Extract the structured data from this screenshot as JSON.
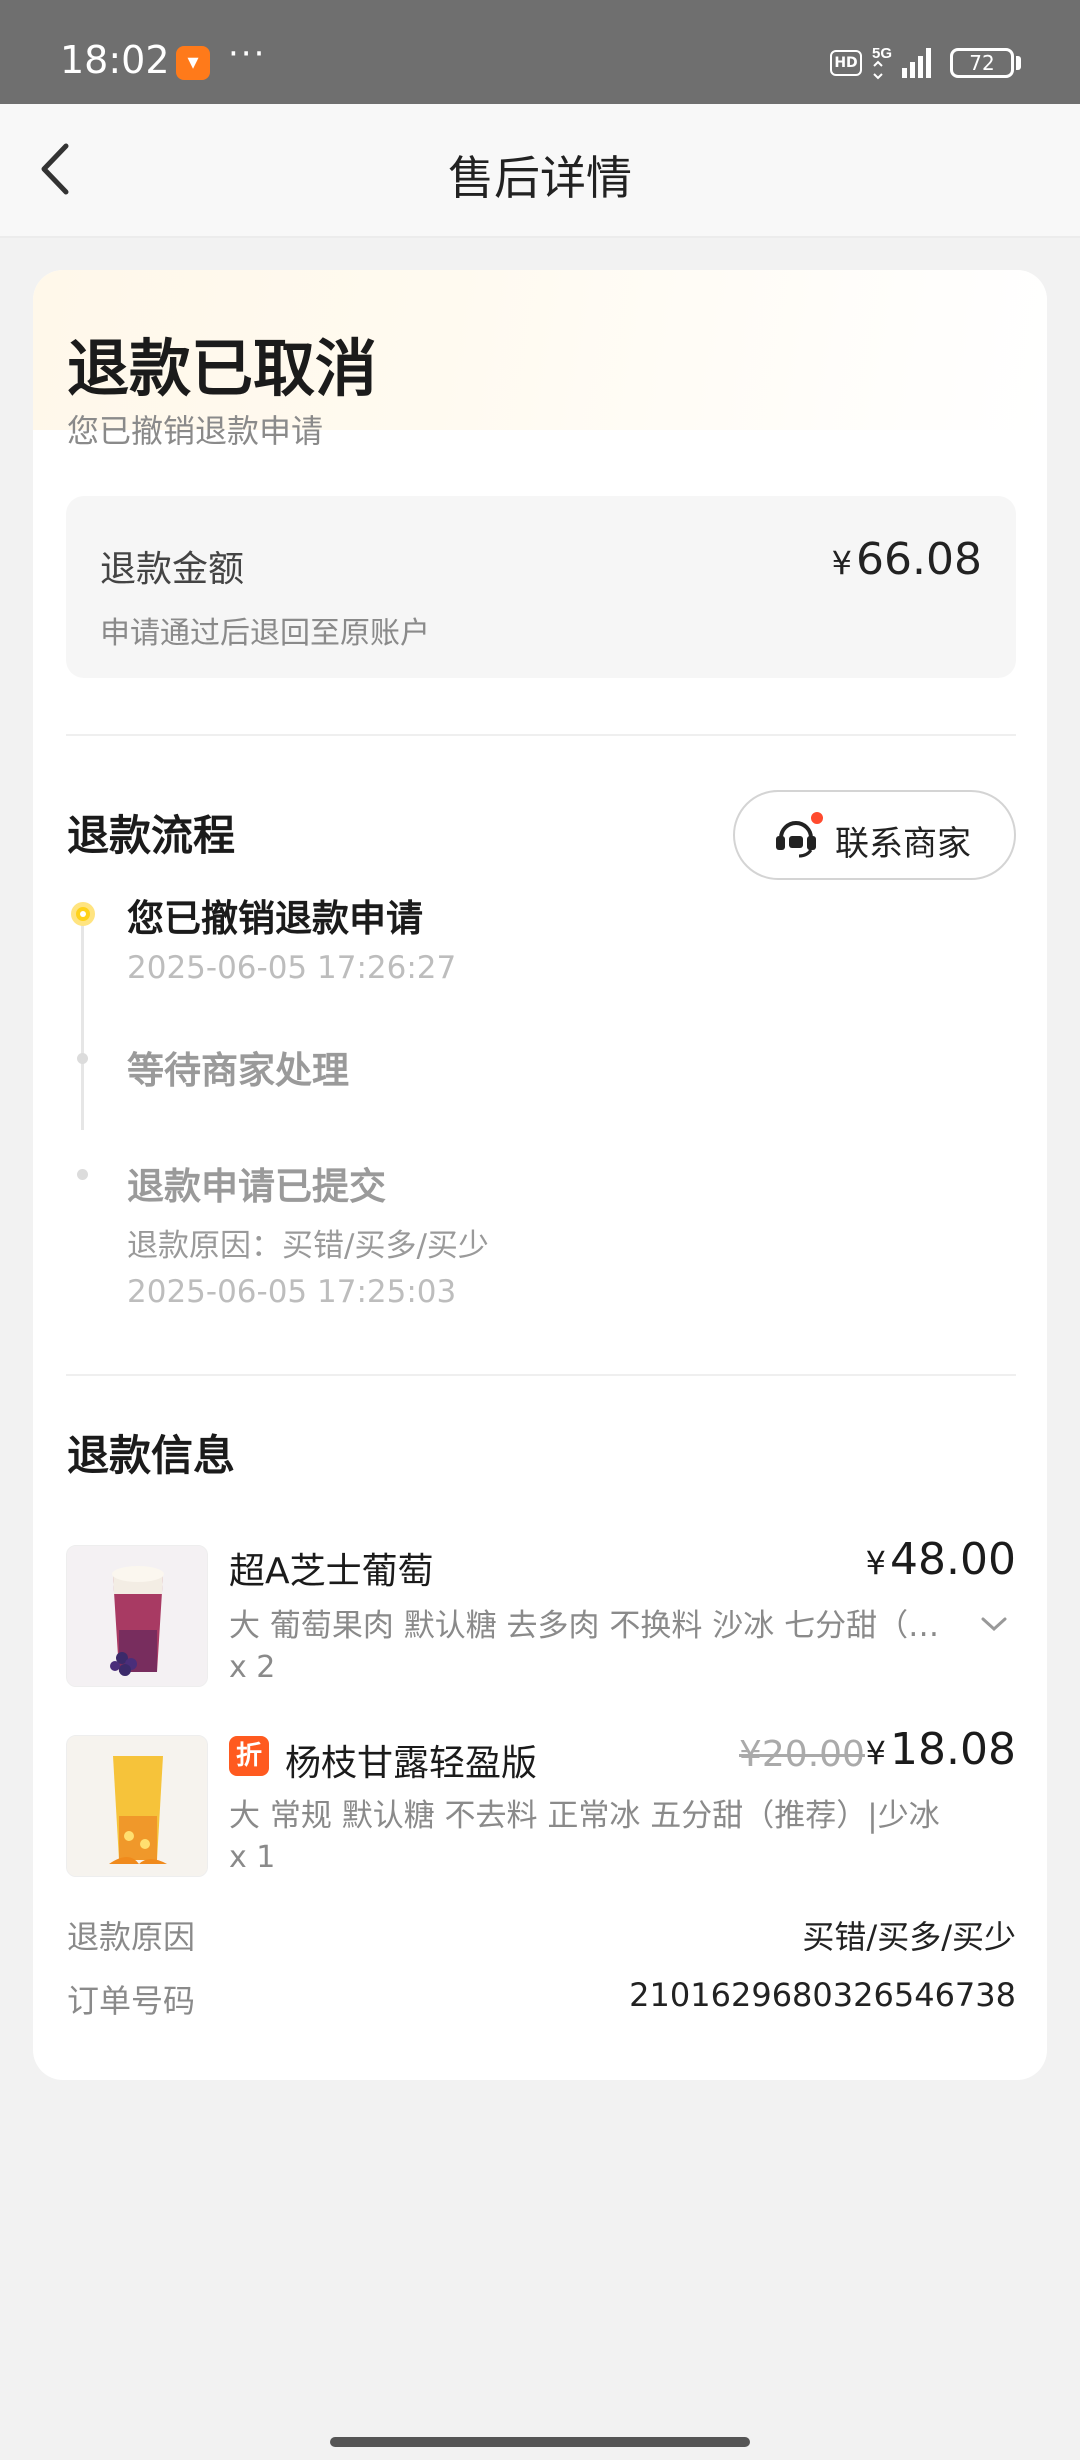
{
  "status_bar": {
    "time": "18:02",
    "app_icon": "meituan-app-icon",
    "more_dots": "···",
    "hd_label": "HD",
    "network_label": "5G",
    "battery_level": "72"
  },
  "nav": {
    "back_icon": "chevron-left-icon",
    "title": "售后详情"
  },
  "refund_status": {
    "title": "退款已取消",
    "description": "您已撤销退款申请"
  },
  "refund_amount": {
    "label": "退款金额",
    "currency": "¥",
    "value": "66.08",
    "note": "申请通过后退回至原账户"
  },
  "process": {
    "title": "退款流程",
    "contact_button_label": "联系商家",
    "contact_icon": "merchant-chat-icon",
    "steps": [
      {
        "title": "您已撤销退款申请",
        "time": "2025-06-05 17:26:27"
      },
      {
        "title": "等待商家处理"
      },
      {
        "title": "退款申请已提交",
        "reason": "退款原因：买错/买多/买少",
        "time": "2025-06-05 17:25:03"
      }
    ]
  },
  "refund_info": {
    "title": "退款信息",
    "products": [
      {
        "name": "超A芝士葡萄",
        "currency": "¥",
        "price": "48.00",
        "spec": "大 葡萄果肉 默认糖 去多肉 不换料 沙冰 七分甜（推荐）",
        "quantity": "x 2",
        "expand_icon": "chevron-down-icon"
      },
      {
        "badge": "折",
        "name": "杨枝甘露轻盈版",
        "old_price": "¥20.00",
        "currency": "¥",
        "price": "18.08",
        "spec": "大 常规 默认糖 不去料 正常冰 五分甜（推荐）|少冰",
        "quantity": "x 1"
      }
    ],
    "reason_label": "退款原因",
    "reason_value": "买错/买多/买少",
    "order_label": "订单号码",
    "order_value": "2101629680326546738"
  },
  "colors": {
    "accent_yellow": "#ffd21a",
    "discount_orange": "#ff5a1f",
    "notification_red": "#ff4a2e"
  }
}
